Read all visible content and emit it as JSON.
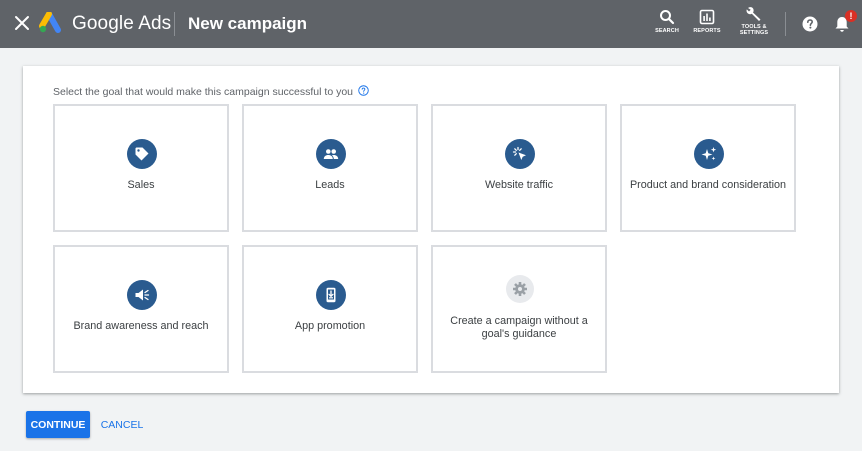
{
  "header": {
    "close_icon": "close-icon",
    "brand": "Google Ads",
    "title": "New campaign",
    "tools": [
      {
        "label": "SEARCH",
        "icon": "search-icon"
      },
      {
        "label": "REPORTS",
        "icon": "reports-icon"
      },
      {
        "label_line1": "TOOLS &",
        "label_line2": "SETTINGS",
        "icon": "wrench-icon"
      }
    ],
    "help_icon": "help-icon",
    "notifications_icon": "bell-icon",
    "notification_badge": "!",
    "background": "#5f6368"
  },
  "goal_selection": {
    "prompt": "Select the goal that would make this campaign successful to you",
    "help_icon": "question-circle-icon",
    "goals": [
      {
        "label": "Sales",
        "icon": "tag-icon"
      },
      {
        "label": "Leads",
        "icon": "people-icon"
      },
      {
        "label": "Website traffic",
        "icon": "cursor-click-icon"
      },
      {
        "label": "Product and brand consideration",
        "icon": "sparkle-icon"
      },
      {
        "label": "Brand awareness and reach",
        "icon": "megaphone-icon"
      },
      {
        "label": "App promotion",
        "icon": "phone-download-icon"
      },
      {
        "label": "Create a campaign without a goal's guidance",
        "icon": "gear-icon"
      }
    ],
    "icon_color": "#2a5b8f",
    "border_color": "#dadce0"
  },
  "actions": {
    "continue_label": "CONTINUE",
    "cancel_label": "CANCEL",
    "accent": "#1a73e8"
  }
}
